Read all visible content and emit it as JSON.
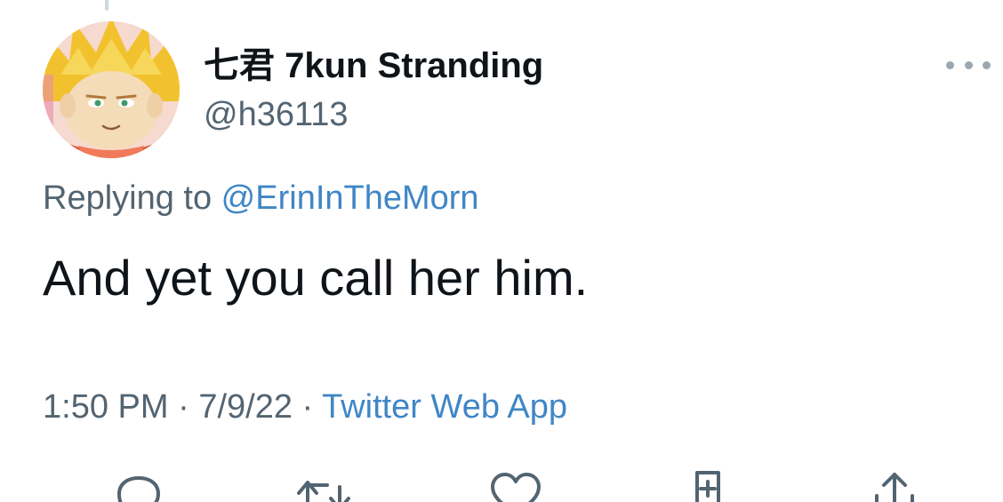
{
  "tweet": {
    "display_name": "七君 7kun Stranding",
    "handle": "@h36113",
    "replying_prefix": "Replying to ",
    "replying_to": "@ErinInTheMorn",
    "text": "And yet you call her him.",
    "time": "1:50 PM",
    "separator": " · ",
    "date": "7/9/22",
    "source": "Twitter Web App"
  },
  "icons": {
    "more": "more-horizontal-icon",
    "reply": "reply-icon",
    "retweet": "retweet-icon",
    "like": "heart-icon",
    "bookmark": "bookmark-icon",
    "share": "share-icon"
  },
  "colors": {
    "text": "#0f1419",
    "secondary": "#536471",
    "link": "#3f86c6",
    "icon": "#536471"
  }
}
